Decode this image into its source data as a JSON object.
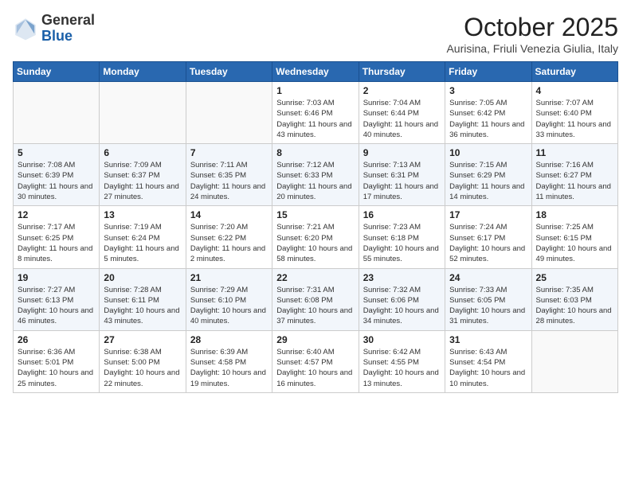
{
  "header": {
    "logo": {
      "general": "General",
      "blue": "Blue"
    },
    "title": "October 2025",
    "subtitle": "Aurisina, Friuli Venezia Giulia, Italy"
  },
  "calendar": {
    "weekdays": [
      "Sunday",
      "Monday",
      "Tuesday",
      "Wednesday",
      "Thursday",
      "Friday",
      "Saturday"
    ],
    "weeks": [
      [
        {
          "day": "",
          "info": ""
        },
        {
          "day": "",
          "info": ""
        },
        {
          "day": "",
          "info": ""
        },
        {
          "day": "1",
          "info": "Sunrise: 7:03 AM\nSunset: 6:46 PM\nDaylight: 11 hours and 43 minutes."
        },
        {
          "day": "2",
          "info": "Sunrise: 7:04 AM\nSunset: 6:44 PM\nDaylight: 11 hours and 40 minutes."
        },
        {
          "day": "3",
          "info": "Sunrise: 7:05 AM\nSunset: 6:42 PM\nDaylight: 11 hours and 36 minutes."
        },
        {
          "day": "4",
          "info": "Sunrise: 7:07 AM\nSunset: 6:40 PM\nDaylight: 11 hours and 33 minutes."
        }
      ],
      [
        {
          "day": "5",
          "info": "Sunrise: 7:08 AM\nSunset: 6:39 PM\nDaylight: 11 hours and 30 minutes."
        },
        {
          "day": "6",
          "info": "Sunrise: 7:09 AM\nSunset: 6:37 PM\nDaylight: 11 hours and 27 minutes."
        },
        {
          "day": "7",
          "info": "Sunrise: 7:11 AM\nSunset: 6:35 PM\nDaylight: 11 hours and 24 minutes."
        },
        {
          "day": "8",
          "info": "Sunrise: 7:12 AM\nSunset: 6:33 PM\nDaylight: 11 hours and 20 minutes."
        },
        {
          "day": "9",
          "info": "Sunrise: 7:13 AM\nSunset: 6:31 PM\nDaylight: 11 hours and 17 minutes."
        },
        {
          "day": "10",
          "info": "Sunrise: 7:15 AM\nSunset: 6:29 PM\nDaylight: 11 hours and 14 minutes."
        },
        {
          "day": "11",
          "info": "Sunrise: 7:16 AM\nSunset: 6:27 PM\nDaylight: 11 hours and 11 minutes."
        }
      ],
      [
        {
          "day": "12",
          "info": "Sunrise: 7:17 AM\nSunset: 6:25 PM\nDaylight: 11 hours and 8 minutes."
        },
        {
          "day": "13",
          "info": "Sunrise: 7:19 AM\nSunset: 6:24 PM\nDaylight: 11 hours and 5 minutes."
        },
        {
          "day": "14",
          "info": "Sunrise: 7:20 AM\nSunset: 6:22 PM\nDaylight: 11 hours and 2 minutes."
        },
        {
          "day": "15",
          "info": "Sunrise: 7:21 AM\nSunset: 6:20 PM\nDaylight: 10 hours and 58 minutes."
        },
        {
          "day": "16",
          "info": "Sunrise: 7:23 AM\nSunset: 6:18 PM\nDaylight: 10 hours and 55 minutes."
        },
        {
          "day": "17",
          "info": "Sunrise: 7:24 AM\nSunset: 6:17 PM\nDaylight: 10 hours and 52 minutes."
        },
        {
          "day": "18",
          "info": "Sunrise: 7:25 AM\nSunset: 6:15 PM\nDaylight: 10 hours and 49 minutes."
        }
      ],
      [
        {
          "day": "19",
          "info": "Sunrise: 7:27 AM\nSunset: 6:13 PM\nDaylight: 10 hours and 46 minutes."
        },
        {
          "day": "20",
          "info": "Sunrise: 7:28 AM\nSunset: 6:11 PM\nDaylight: 10 hours and 43 minutes."
        },
        {
          "day": "21",
          "info": "Sunrise: 7:29 AM\nSunset: 6:10 PM\nDaylight: 10 hours and 40 minutes."
        },
        {
          "day": "22",
          "info": "Sunrise: 7:31 AM\nSunset: 6:08 PM\nDaylight: 10 hours and 37 minutes."
        },
        {
          "day": "23",
          "info": "Sunrise: 7:32 AM\nSunset: 6:06 PM\nDaylight: 10 hours and 34 minutes."
        },
        {
          "day": "24",
          "info": "Sunrise: 7:33 AM\nSunset: 6:05 PM\nDaylight: 10 hours and 31 minutes."
        },
        {
          "day": "25",
          "info": "Sunrise: 7:35 AM\nSunset: 6:03 PM\nDaylight: 10 hours and 28 minutes."
        }
      ],
      [
        {
          "day": "26",
          "info": "Sunrise: 6:36 AM\nSunset: 5:01 PM\nDaylight: 10 hours and 25 minutes."
        },
        {
          "day": "27",
          "info": "Sunrise: 6:38 AM\nSunset: 5:00 PM\nDaylight: 10 hours and 22 minutes."
        },
        {
          "day": "28",
          "info": "Sunrise: 6:39 AM\nSunset: 4:58 PM\nDaylight: 10 hours and 19 minutes."
        },
        {
          "day": "29",
          "info": "Sunrise: 6:40 AM\nSunset: 4:57 PM\nDaylight: 10 hours and 16 minutes."
        },
        {
          "day": "30",
          "info": "Sunrise: 6:42 AM\nSunset: 4:55 PM\nDaylight: 10 hours and 13 minutes."
        },
        {
          "day": "31",
          "info": "Sunrise: 6:43 AM\nSunset: 4:54 PM\nDaylight: 10 hours and 10 minutes."
        },
        {
          "day": "",
          "info": ""
        }
      ]
    ]
  }
}
